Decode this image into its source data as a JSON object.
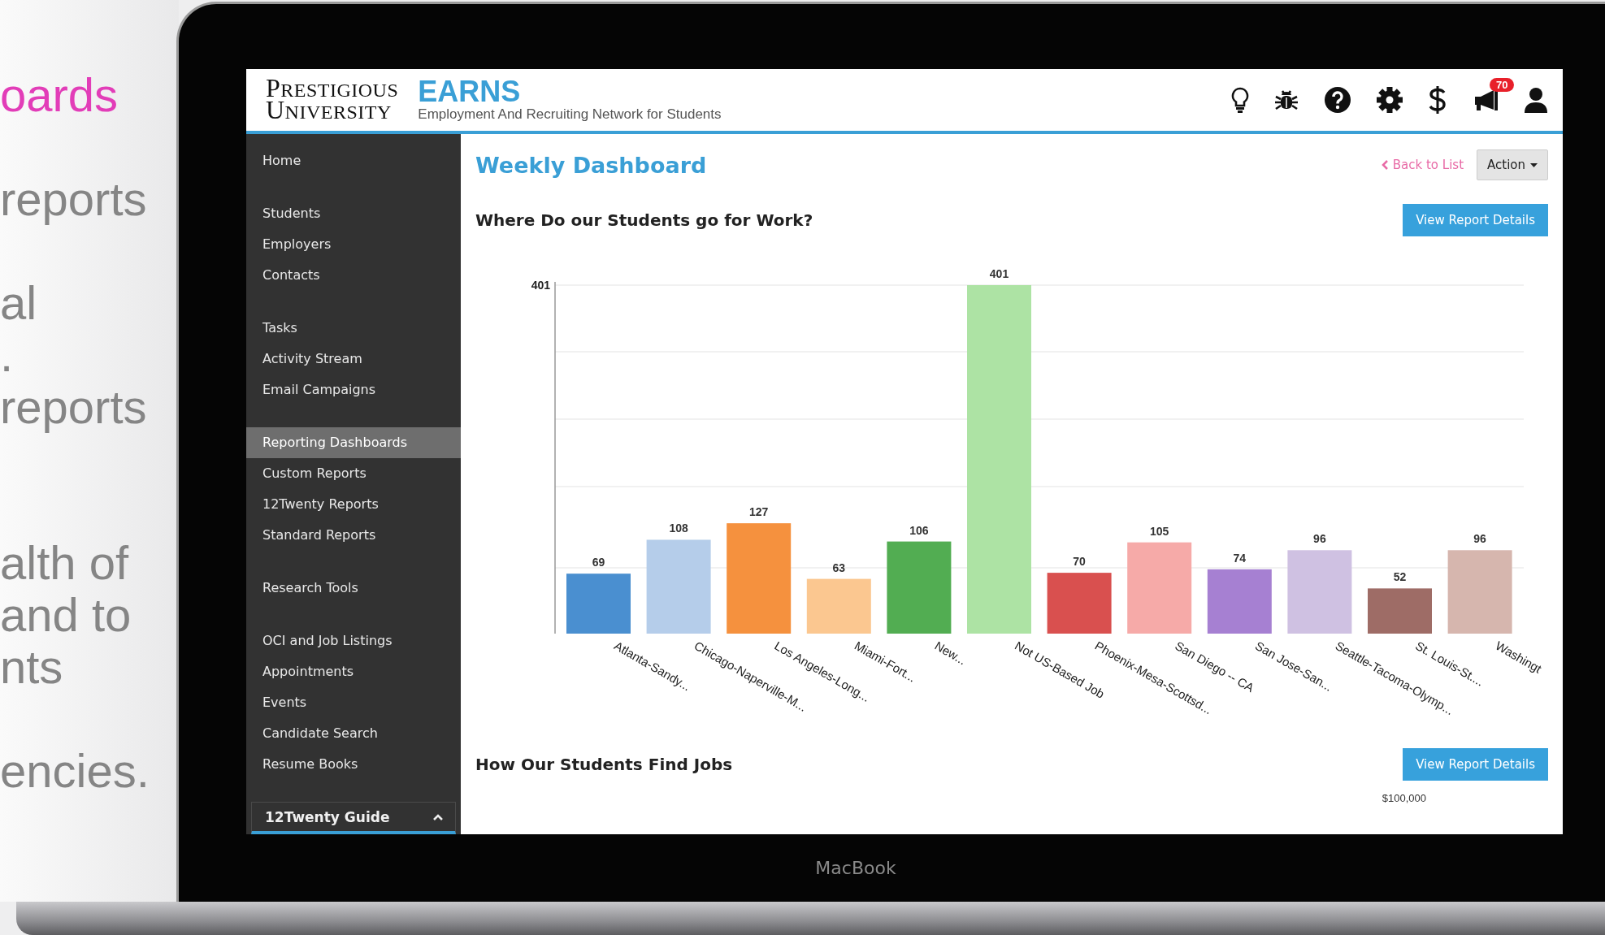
{
  "slide_text": {
    "title": "oards",
    "paragraphs": [
      [
        "reports"
      ],
      [
        "al",
        ".",
        "reports"
      ],
      [
        "alth of",
        "and to",
        "nts"
      ],
      [
        "encies."
      ]
    ]
  },
  "header": {
    "logo_lines": [
      "PRESTIGIOUS",
      "UNIVERSITY"
    ],
    "brand": "EARNS",
    "tagline": "Employment And Recruiting Network for Students",
    "badge": "70"
  },
  "sidebar": {
    "groups": [
      [
        {
          "label": "Home",
          "selected": false
        }
      ],
      [
        {
          "label": "Students",
          "selected": false
        },
        {
          "label": "Employers",
          "selected": false
        },
        {
          "label": "Contacts",
          "selected": false
        }
      ],
      [
        {
          "label": "Tasks",
          "selected": false
        },
        {
          "label": "Activity Stream",
          "selected": false
        },
        {
          "label": "Email Campaigns",
          "selected": false
        }
      ],
      [
        {
          "label": "Reporting Dashboards",
          "selected": true
        },
        {
          "label": "Custom Reports",
          "selected": false
        },
        {
          "label": "12Twenty Reports",
          "selected": false
        },
        {
          "label": "Standard Reports",
          "selected": false
        }
      ],
      [
        {
          "label": "Research Tools",
          "selected": false
        }
      ],
      [
        {
          "label": "OCI and Job Listings",
          "selected": false
        },
        {
          "label": "Appointments",
          "selected": false
        },
        {
          "label": "Events",
          "selected": false
        },
        {
          "label": "Candidate Search",
          "selected": false
        },
        {
          "label": "Resume Books",
          "selected": false
        }
      ]
    ],
    "guide": {
      "label": "12Twenty Guide",
      "expanded": true
    }
  },
  "page": {
    "title": "Weekly Dashboard",
    "back_link": "Back to List",
    "action_button": "Action"
  },
  "sections": [
    {
      "title": "Where Do our Students go for Work?",
      "button": "View Report Details",
      "chart_data": {
        "type": "bar",
        "categories": [
          "Atlanta-Sandy...",
          "Chicago-Naperville-M...",
          "Los Angeles-Long...",
          "Miami-Fort...",
          "New...",
          "Not US-Based Job",
          "Phoenix-Mesa-Scottsd...",
          "San Diego -- CA",
          "San Jose-San...",
          "Seattle-Tacoma-Olymp...",
          "St. Louis-St....",
          "Washingt"
        ],
        "values": [
          69,
          108,
          127,
          63,
          106,
          401,
          70,
          105,
          74,
          96,
          52,
          96
        ],
        "colors": [
          "#4a8fd0",
          "#b5cdea",
          "#f5913e",
          "#fbc790",
          "#52ad52",
          "#ade3a4",
          "#d9504f",
          "#f6aaa8",
          "#a680d2",
          "#cfc1e2",
          "#9e6c66",
          "#d6b6ae"
        ],
        "data_labels": true
      },
      "axis_top_label": "401"
    },
    {
      "title": "How Our Students Find Jobs",
      "button": "View Report Details",
      "visible_tick": "$100,000"
    }
  ],
  "laptop_label": "MacBook"
}
